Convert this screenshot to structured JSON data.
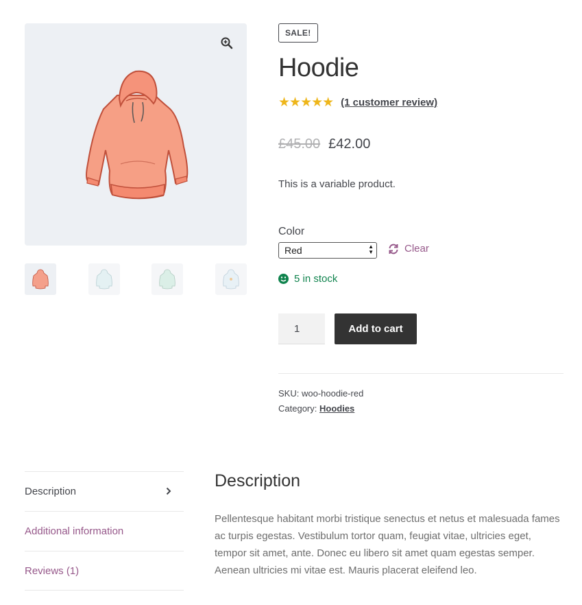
{
  "product": {
    "sale_badge": "SALE!",
    "title": "Hoodie",
    "stars": "★★★★★",
    "review_link": "(1 customer review)",
    "price_old": "£45.00",
    "price_new": "£42.00",
    "short_description": "This is a variable product.",
    "color_label": "Color",
    "color_selected": "Red",
    "clear_label": "Clear",
    "stock_text": "5 in stock",
    "quantity": "1",
    "add_to_cart": "Add to cart",
    "sku_label": "SKU:",
    "sku_value": "woo-hoodie-red",
    "category_label": "Category:",
    "category_value": "Hoodies"
  },
  "gallery": {
    "main_image_icon": "hoodie-image",
    "zoom_icon": "zoom-icon",
    "thumbnails": [
      "pink-hoodie",
      "blue-hoodie",
      "green-hoodie",
      "blue-logo-hoodie"
    ]
  },
  "tabs": [
    {
      "label": "Description",
      "active": true
    },
    {
      "label": "Additional information",
      "active": false
    },
    {
      "label": "Reviews (1)",
      "active": false
    }
  ],
  "description": {
    "title": "Description",
    "body": "Pellentesque habitant morbi tristique senectus et netus et malesuada fames ac turpis egestas. Vestibulum tortor quam, feugiat vitae, ultricies eget, tempor sit amet, ante. Donec eu libero sit amet quam egestas semper. Aenean ultricies mi vitae est. Mauris placerat eleifend leo."
  },
  "colors": {
    "accent": "#96588a",
    "stock": "#0f834d",
    "star": "#eeb61b",
    "button": "#333333"
  }
}
